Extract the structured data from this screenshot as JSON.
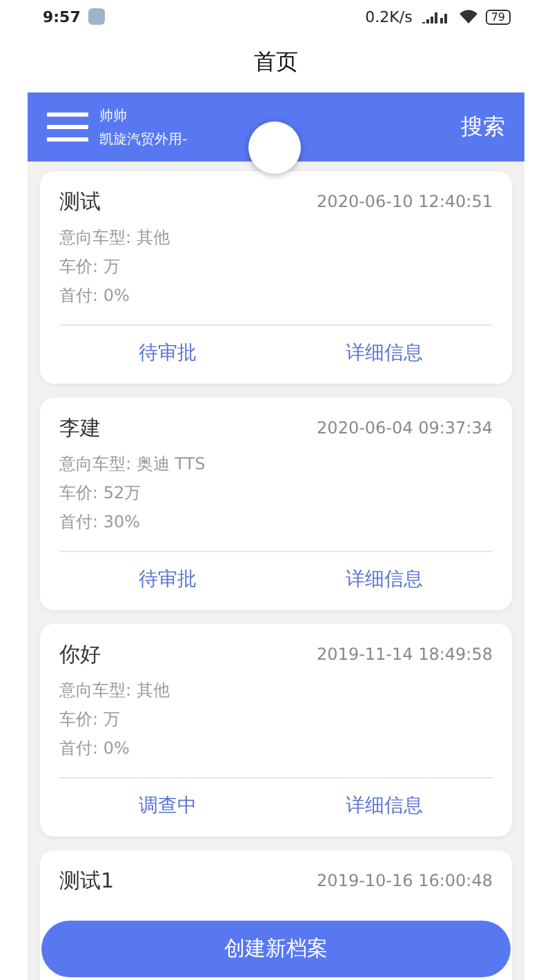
{
  "status_bar": {
    "time": "9:57",
    "speed": "0.2K/s",
    "battery": "79"
  },
  "title": "首页",
  "header": {
    "user": "帅帅",
    "company": "凯旋汽贸外用-",
    "search": "搜索"
  },
  "records": [
    {
      "name": "测试",
      "time": "2020-06-10 12:40:51",
      "details": [
        "意向车型: 其他",
        "车价: 万",
        "首付: 0%"
      ],
      "status": "待审批",
      "detail_link": "详细信息"
    },
    {
      "name": "李建",
      "time": "2020-06-04 09:37:34",
      "details": [
        "意向车型: 奥迪 TTS",
        "车价: 52万",
        "首付: 30%"
      ],
      "status": "待审批",
      "detail_link": "详细信息"
    },
    {
      "name": "你好",
      "time": "2019-11-14 18:49:58",
      "details": [
        "意向车型: 其他",
        "车价: 万",
        "首付: 0%"
      ],
      "status": "调查中",
      "detail_link": "详细信息"
    },
    {
      "name": "测试1",
      "time": "2019-10-16 16:00:48"
    }
  ],
  "create_button": "创建新档案"
}
